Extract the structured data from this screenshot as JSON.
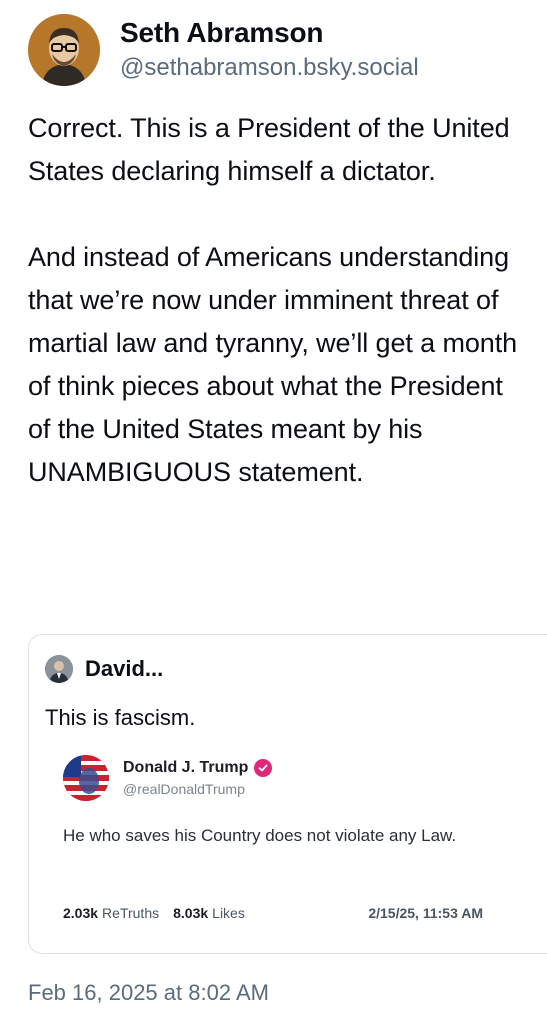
{
  "author": {
    "display_name": "Seth Abramson",
    "handle": "@sethabramson.bsky.social"
  },
  "post": {
    "text": "Correct. This is a President of the United States declaring himself a dictator.\n\nAnd instead of Americans understanding that we’re now under imminent threat of martial law and tyranny, we’ll get a month of think pieces about what the President of the United States meant by his UNAMBIGUOUS statement.",
    "timestamp": "Feb 16, 2025 at 8:02 AM"
  },
  "quote": {
    "author_name": "David...",
    "text": "This is fascism.",
    "embed": {
      "name": "Donald J. Trump",
      "handle": "@realDonaldTrump",
      "text": "He who saves his Country does not violate any Law.",
      "retruths_count": "2.03k",
      "retruths_label": "ReTruths",
      "likes_count": "8.03k",
      "likes_label": "Likes",
      "date": "2/15/25, 11:53 AM"
    }
  },
  "colors": {
    "text_primary": "#0b0f14",
    "text_secondary": "#5b6b7e",
    "border": "#dbe1e8",
    "verified_badge": "#e0287a"
  }
}
